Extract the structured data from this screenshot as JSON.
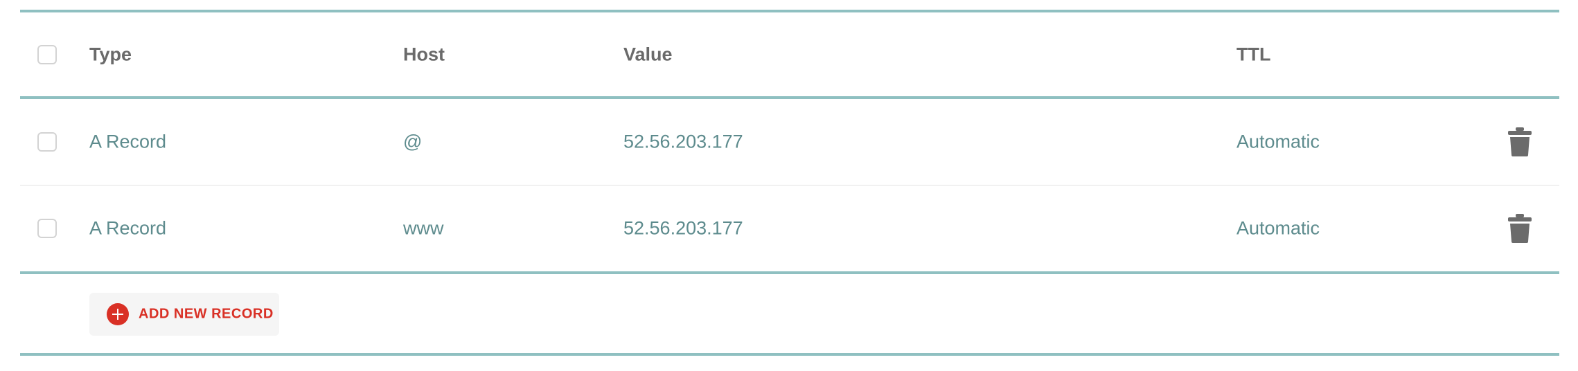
{
  "table": {
    "columns": {
      "type": "Type",
      "host": "Host",
      "value": "Value",
      "ttl": "TTL"
    },
    "rows": [
      {
        "type": "A Record",
        "host": "@",
        "value": "52.56.203.177",
        "ttl": "Automatic"
      },
      {
        "type": "A Record",
        "host": "www",
        "value": "52.56.203.177",
        "ttl": "Automatic"
      }
    ]
  },
  "actions": {
    "add_label": "ADD NEW RECORD"
  },
  "icons": {
    "delete": "trash-icon",
    "add": "plus-circle-icon"
  },
  "colors": {
    "rule": "#8fc0c1",
    "cell_text": "#5d8b8d",
    "header_text": "#6a6a6a",
    "add_accent": "#d93025",
    "trash": "#6b6b6b"
  }
}
